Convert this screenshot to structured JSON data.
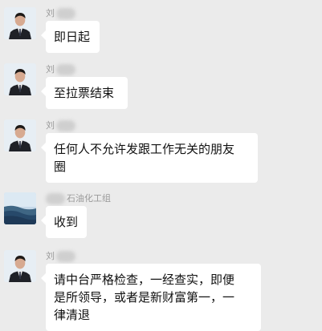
{
  "messages": [
    {
      "sender": "刘",
      "text": "即日起"
    },
    {
      "sender": "刘",
      "text": "至拉票结束"
    },
    {
      "sender": "刘",
      "text": "任何人不允许发跟工作无关的朋友\n圈"
    },
    {
      "sender": "石油化工组",
      "text": "收到"
    },
    {
      "sender": "刘",
      "text": "请中台严格检查，一经查实，即便\n是所领导，或者是新财富第一，一\n律清退"
    }
  ],
  "avatars": {
    "person": "person-in-suit-avatar",
    "landscape": "seaside-landscape-avatar"
  }
}
